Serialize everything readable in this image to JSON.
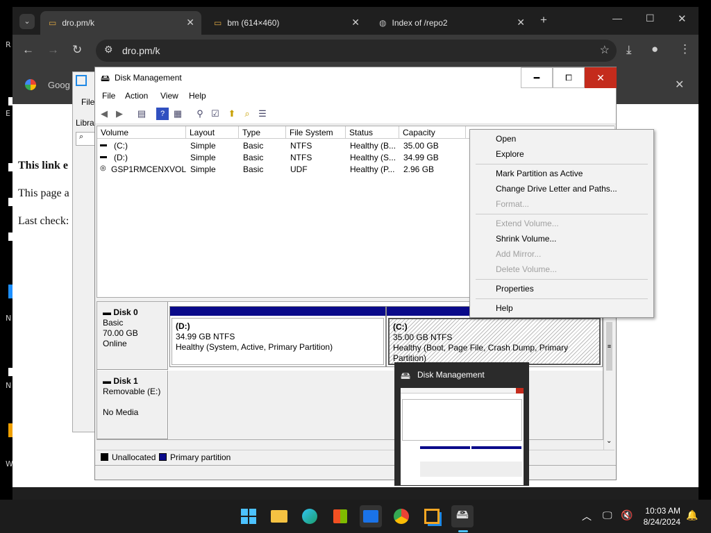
{
  "desktop": {
    "edge_labels": [
      "R",
      "E",
      "N",
      "N",
      "W"
    ]
  },
  "browser": {
    "tabs": [
      {
        "title": "dro.pm/k",
        "active": true
      },
      {
        "title": "bm (614×460)",
        "active": false
      },
      {
        "title": "Index of /repo2",
        "active": false
      }
    ],
    "address": "dro.pm/k",
    "bookmark": "Goog",
    "page": {
      "line1": "This link e",
      "line2": "This page a",
      "line3": "Last check:"
    }
  },
  "bg_window": {
    "menu_label": "File",
    "side_label": "Libra"
  },
  "disk_management": {
    "title": "Disk Management",
    "menu": [
      "File",
      "Action",
      "View",
      "Help"
    ],
    "columns": [
      "Volume",
      "Layout",
      "Type",
      "File System",
      "Status",
      "Capacity"
    ],
    "volumes": [
      {
        "volume": "(C:)",
        "layout": "Simple",
        "type": "Basic",
        "fs": "NTFS",
        "status": "Healthy (B...",
        "capacity": "35.00 GB"
      },
      {
        "volume": "(D:)",
        "layout": "Simple",
        "type": "Basic",
        "fs": "NTFS",
        "status": "Healthy (S...",
        "capacity": "34.99 GB"
      },
      {
        "volume": "GSP1RMCENXVOL...",
        "layout": "Simple",
        "type": "Basic",
        "fs": "UDF",
        "status": "Healthy (P...",
        "capacity": "2.96 GB"
      }
    ],
    "disks": [
      {
        "name": "Disk 0",
        "type": "Basic",
        "size": "70.00 GB",
        "state": "Online"
      },
      {
        "name": "Disk 1",
        "type": "Removable (E:)",
        "size": "",
        "state": "No Media"
      }
    ],
    "partitions": [
      {
        "letter": "(D:)",
        "size": "34.99 GB NTFS",
        "status": "Healthy (System, Active, Primary Partition)"
      },
      {
        "letter": "(C:)",
        "size": "35.00 GB NTFS",
        "status": "Healthy (Boot, Page File, Crash Dump, Primary Partition)"
      }
    ],
    "legend": [
      "Unallocated",
      "Primary partition"
    ]
  },
  "context_menu": {
    "items": [
      {
        "label": "Open",
        "enabled": true
      },
      {
        "label": "Explore",
        "enabled": true
      },
      {
        "label": "Mark Partition as Active",
        "enabled": true
      },
      {
        "label": "Change Drive Letter and Paths...",
        "enabled": true
      },
      {
        "label": "Format...",
        "enabled": false
      },
      {
        "label": "Extend Volume...",
        "enabled": false
      },
      {
        "label": "Shrink Volume...",
        "enabled": true
      },
      {
        "label": "Add Mirror...",
        "enabled": false
      },
      {
        "label": "Delete Volume...",
        "enabled": false
      },
      {
        "label": "Properties",
        "enabled": true
      },
      {
        "label": "Help",
        "enabled": true
      }
    ]
  },
  "taskbar_preview": {
    "title": "Disk Management"
  },
  "taskbar": {
    "time": "10:03 AM",
    "date": "8/24/2024",
    "apps": [
      "start-icon",
      "file-explorer-icon",
      "edge-icon",
      "store-icon",
      "outlook-icon",
      "chrome-icon",
      "vmware-icon",
      "disk-management-icon"
    ]
  },
  "colors": {
    "primary_partition": "#0a0a8a",
    "chrome_dark": "#1f1f1f",
    "close_red": "#c42b1c"
  }
}
